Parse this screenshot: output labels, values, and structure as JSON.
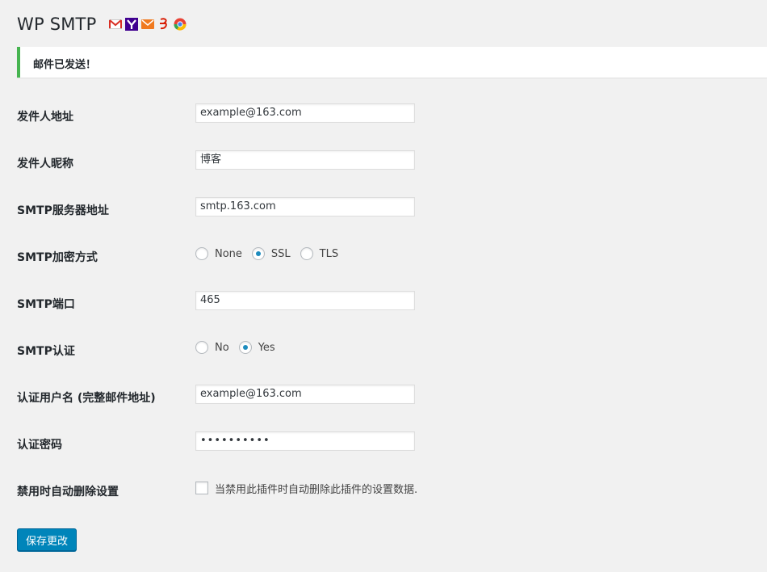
{
  "header": {
    "title": "WP SMTP",
    "icons": [
      "gmail-icon",
      "yahoo-icon",
      "outlook-mail-icon",
      "netease-163-icon",
      "chrome-like-icon"
    ]
  },
  "notice": {
    "text": "邮件已发送！",
    "color": "#46b450"
  },
  "form": {
    "sender_address": {
      "label": "发件人地址",
      "value": "example@163.com"
    },
    "sender_name": {
      "label": "发件人昵称",
      "value": "博客"
    },
    "smtp_host": {
      "label": "SMTP服务器地址",
      "value": "smtp.163.com"
    },
    "smtp_secure": {
      "label": "SMTP加密方式",
      "options": [
        "None",
        "SSL",
        "TLS"
      ],
      "selected": "SSL"
    },
    "smtp_port": {
      "label": "SMTP端口",
      "value": "465"
    },
    "smtp_auth": {
      "label": "SMTP认证",
      "options": [
        "No",
        "Yes"
      ],
      "selected": "Yes"
    },
    "auth_username": {
      "label": "认证用户名 (完整邮件地址)",
      "value": "example@163.com"
    },
    "auth_password": {
      "label": "认证密码",
      "value": "••••••••••"
    },
    "delete_on_deactivate": {
      "label": "禁用时自动删除设置",
      "checkbox_label": "当禁用此插件时自动删除此插件的设置数据.",
      "checked": false
    }
  },
  "submit": {
    "label": "保存更改",
    "color": "#0085ba"
  }
}
